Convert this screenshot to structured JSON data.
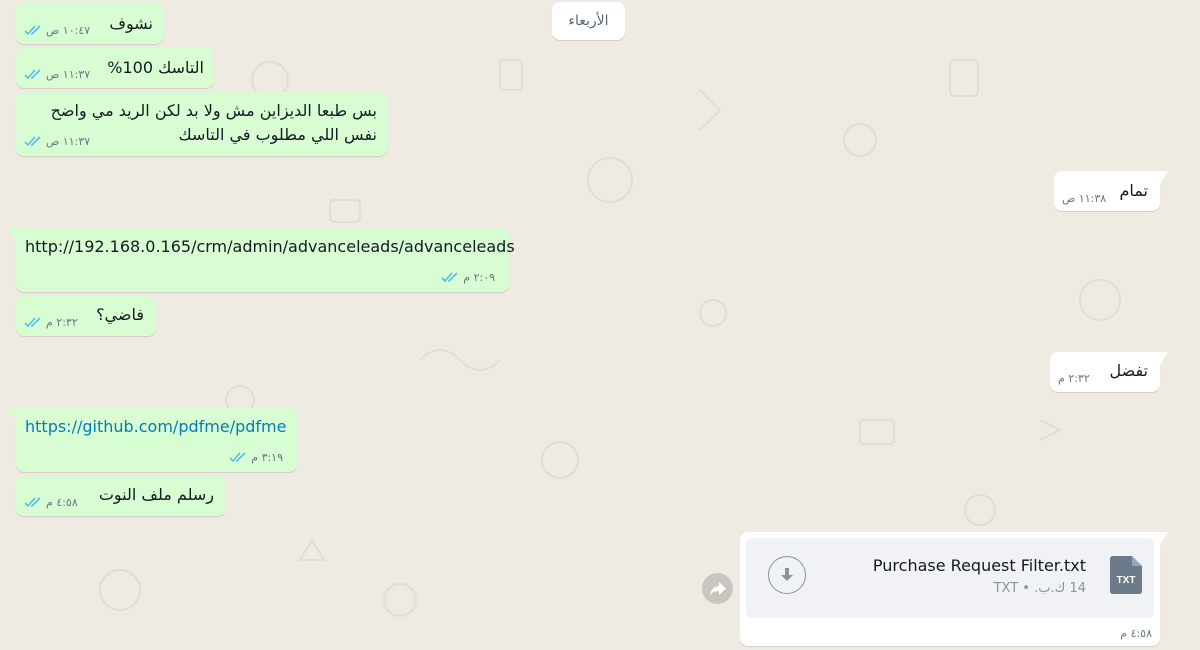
{
  "date_divider": "الأربعاء",
  "messages": [
    {
      "id": "m1",
      "text": "نشوف",
      "time": "١٠:٤٧ ص",
      "direction": "outgoing",
      "read": true
    },
    {
      "id": "m2",
      "text": "التاسك 100%",
      "time": "١١:٣٧ ص",
      "direction": "outgoing",
      "read": true
    },
    {
      "id": "m3",
      "lines": [
        "بس طبعا الديزاين مش ولا بد لكن الريد مي واضح",
        "نفس اللي مطلوب في التاسك"
      ],
      "time": "١١:٣٧ ص",
      "direction": "outgoing",
      "read": true
    },
    {
      "id": "m4",
      "text": "تمام",
      "time": "١١:٣٨ ص",
      "direction": "incoming"
    },
    {
      "id": "m5",
      "text": "http://192.168.0.165/crm/admin/advanceleads/advanceleads",
      "time": "٢:٠٩ م",
      "direction": "outgoing",
      "read": true
    },
    {
      "id": "m6",
      "text": "فاضي؟",
      "time": "٢:٣٢ م",
      "direction": "outgoing",
      "read": true
    },
    {
      "id": "m7",
      "text": "تفضل",
      "time": "٢:٣٢ م",
      "direction": "incoming"
    },
    {
      "id": "m8",
      "text": "https://github.com/pdfme/pdfme",
      "time": "٣:١٩ م",
      "direction": "outgoing",
      "read": true,
      "is_link": true
    },
    {
      "id": "m9",
      "text": "رسلم ملف النوت",
      "time": "٤:٥٨ م",
      "direction": "outgoing",
      "read": true
    },
    {
      "id": "m10",
      "type": "file",
      "file_name": "Purchase Request Filter.txt",
      "file_type": "TXT",
      "file_size": "14 ك.ب.",
      "file_meta": "14 ك.ب. • TXT",
      "icon_label": "TXT",
      "time": "٤:٥٨ م",
      "direction": "incoming"
    }
  ],
  "colors": {
    "outgoing_bubble": "#d9fdd3",
    "incoming_bubble": "#ffffff",
    "background": "#efeae2",
    "read_ticks": "#53bdeb",
    "link": "#027eb5"
  },
  "icons": {
    "download": "download-icon",
    "forward": "forward-icon",
    "read": "double-check-icon",
    "file": "txt-file-icon"
  }
}
